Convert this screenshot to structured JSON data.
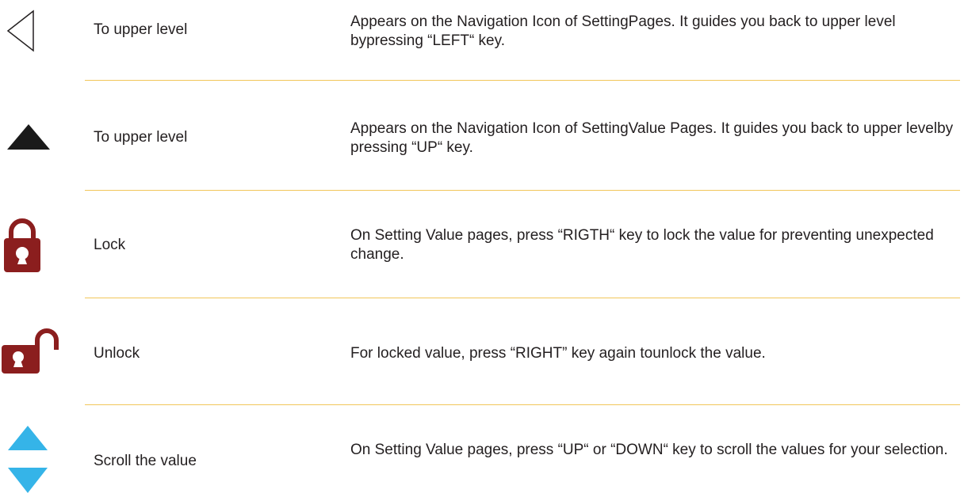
{
  "colors": {
    "text": "#231f20",
    "divider": "#f1c65a",
    "lock": "#8b1e1e",
    "scroll_arrow": "#35b4e8",
    "triangle": "#1a1a1a"
  },
  "rows": [
    {
      "icon": "left-arrow-outline-icon",
      "label": "To upper level",
      "description": "Appears on the Navigation Icon of SettingPages. It guides you back to upper level bypressing “LEFT“ key."
    },
    {
      "icon": "up-triangle-icon",
      "label": "To upper level",
      "description": "Appears on the Navigation Icon of SettingValue Pages. It guides you back to upper levelby pressing “UP“ key."
    },
    {
      "icon": "lock-icon",
      "label": "Lock",
      "description": "On Setting Value pages, press “RIGTH“ key to lock the value for preventing unexpected change."
    },
    {
      "icon": "unlock-icon",
      "label": "Unlock",
      "description": "For locked value, press “RIGHT” key again tounlock the value."
    },
    {
      "icon": "scroll-arrows-icon",
      "label": "Scroll the value",
      "description": "On Setting Value pages, press “UP“ or “DOWN“ key to scroll the values for your selection."
    }
  ]
}
